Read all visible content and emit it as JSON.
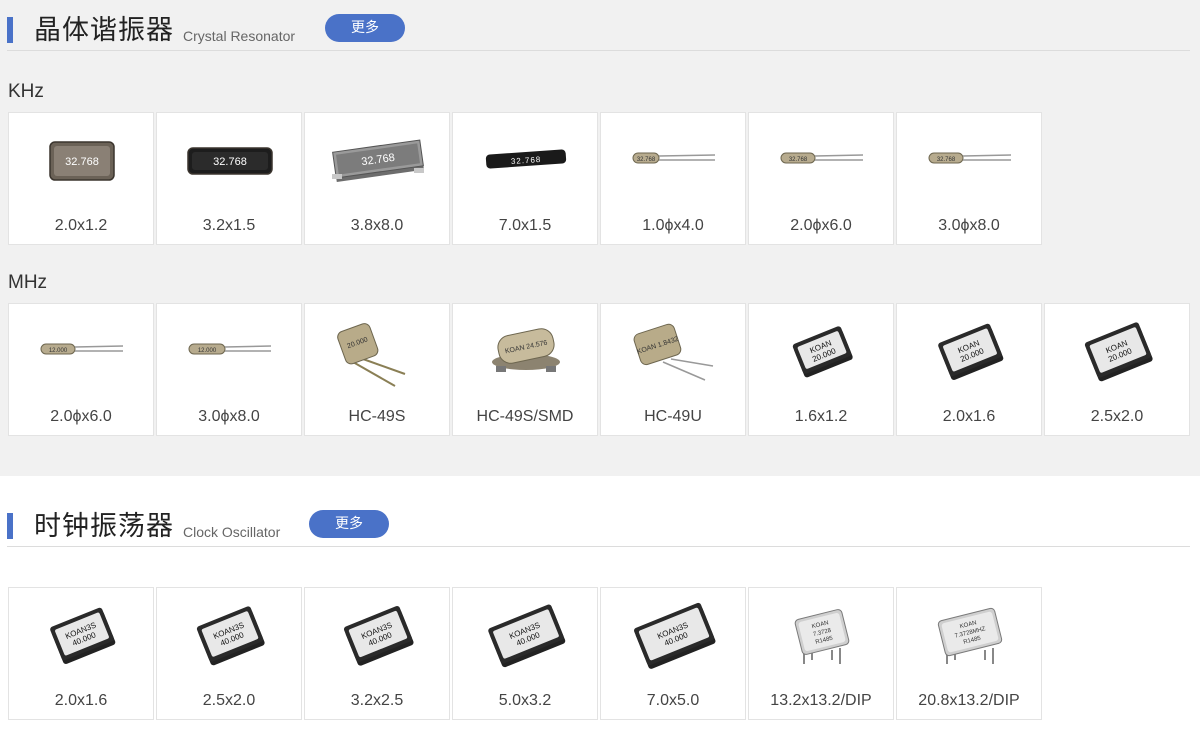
{
  "crystal": {
    "title_cn": "晶体谐振器",
    "title_en": "Crystal Resonator",
    "more_label": "更多",
    "khz_label": "KHz",
    "khz_items": [
      {
        "label": "2.0x1.2",
        "marking": "32.768"
      },
      {
        "label": "3.2x1.5",
        "marking": "32.768"
      },
      {
        "label": "3.8x8.0",
        "marking": "32.768"
      },
      {
        "label": "7.0x1.5",
        "marking": "32.768"
      },
      {
        "label": "1.0ϕx4.0",
        "marking": "32.768"
      },
      {
        "label": "2.0ϕx6.0",
        "marking": "32.768"
      },
      {
        "label": "3.0ϕx8.0",
        "marking": "32.768"
      }
    ],
    "mhz_label": "MHz",
    "mhz_items": [
      {
        "label": "2.0ϕx6.0",
        "marking": "12.000"
      },
      {
        "label": "3.0ϕx8.0",
        "marking": "12.000"
      },
      {
        "label": "HC-49S",
        "marking": "20.000"
      },
      {
        "label": "HC-49S/SMD",
        "marking": "KOAN 24.576"
      },
      {
        "label": "HC-49U",
        "marking": "KOAN 1.8432"
      },
      {
        "label": "1.6x1.2",
        "marking": "KOAN 20.000"
      },
      {
        "label": "2.0x1.6",
        "marking": "KOAN 20.000"
      },
      {
        "label": "2.5x2.0",
        "marking": "KOAN 20.000"
      }
    ]
  },
  "oscillator": {
    "title_cn": "时钟振荡器",
    "title_en": "Clock Oscillator",
    "more_label": "更多",
    "items": [
      {
        "label": "2.0x1.6",
        "marking": "KOAN3S 40.000"
      },
      {
        "label": "2.5x2.0",
        "marking": "KOAN3S 40.000"
      },
      {
        "label": "3.2x2.5",
        "marking": "KOAN3S 40.000"
      },
      {
        "label": "5.0x3.2",
        "marking": "KOAN3S 40.000"
      },
      {
        "label": "7.0x5.0",
        "marking": "KOAN3S 40.000"
      },
      {
        "label": "13.2x13.2/DIP",
        "marking": "KOAN 7.3728 R1485"
      },
      {
        "label": "20.8x13.2/DIP",
        "marking": "KOAN 7.3728MHZ R1485"
      }
    ]
  },
  "colors": {
    "accent": "#4a72c8",
    "section_bg": "#f1f1f1",
    "card_border": "#e3e3e3"
  }
}
